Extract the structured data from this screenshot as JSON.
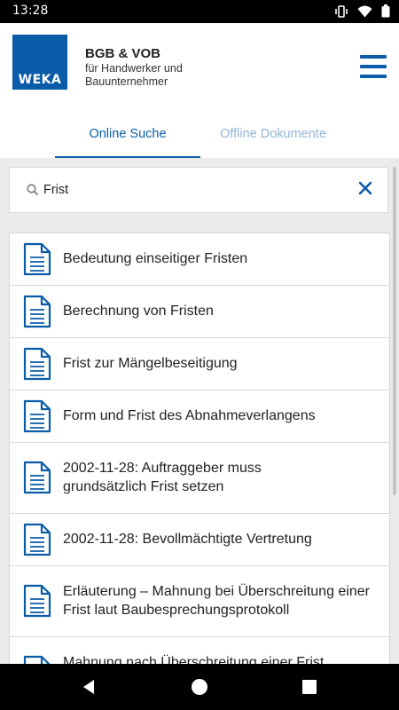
{
  "status_bar": {
    "time": "13:28"
  },
  "header": {
    "logo_text": "WEKA",
    "title": "BGB & VOB",
    "subtitle": "für Handwerker und Bauunternehmer"
  },
  "tabs": [
    {
      "label": "Online Suche",
      "active": true
    },
    {
      "label": "Offline Dokumente",
      "active": false
    }
  ],
  "search": {
    "value": "Frist"
  },
  "results": [
    {
      "title": "Bedeutung einseitiger Fristen"
    },
    {
      "title": "Berechnung von Fristen"
    },
    {
      "title": "Frist zur Mängelbeseitigung"
    },
    {
      "title": "Form und Frist des Abnahmeverlangens"
    },
    {
      "title": "2002-11-28: Auftraggeber muss grundsätzlich Frist setzen"
    },
    {
      "title": "2002-11-28: Bevollmächtigte Vertretung"
    },
    {
      "title": "Erläuterung – Mahnung bei Überschreitung einer Frist laut Baubesprechungsprotokoll"
    },
    {
      "title": "Mahnung nach Überschreitung einer Frist"
    }
  ],
  "colors": {
    "accent": "#0a5ca8",
    "inactive_tab": "#93b6d8",
    "list_background": "#ebebeb"
  }
}
